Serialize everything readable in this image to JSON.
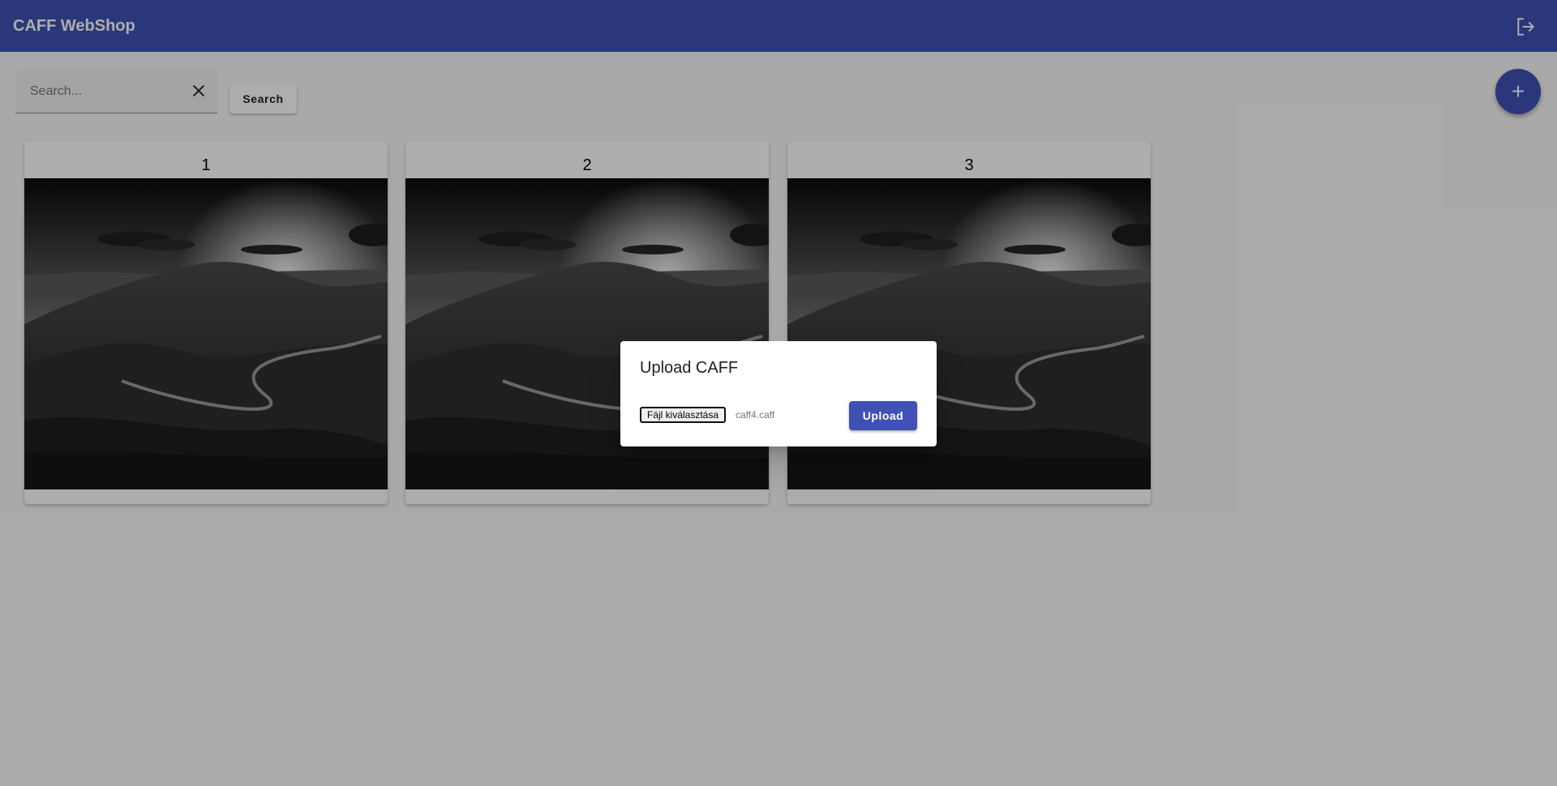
{
  "app": {
    "title": "CAFF WebShop",
    "icons": {
      "logout": "logout-icon",
      "add": "add-icon",
      "clear": "close-icon"
    },
    "colors": {
      "primary": "#3f51b5",
      "backdrop": "rgba(0,0,0,0.32)"
    }
  },
  "search": {
    "placeholder": "Search...",
    "button_label": "Search"
  },
  "fab": {
    "label": "+"
  },
  "cards": [
    {
      "title": "1",
      "image": "landscape-thumbnail"
    },
    {
      "title": "2",
      "image": "landscape-thumbnail"
    },
    {
      "title": "3",
      "image": "landscape-thumbnail"
    }
  ],
  "dialog": {
    "title": "Upload CAFF",
    "file_button_label": "Fájl kiválasztása",
    "file_name": "caff4.caff",
    "upload_label": "Upload"
  }
}
